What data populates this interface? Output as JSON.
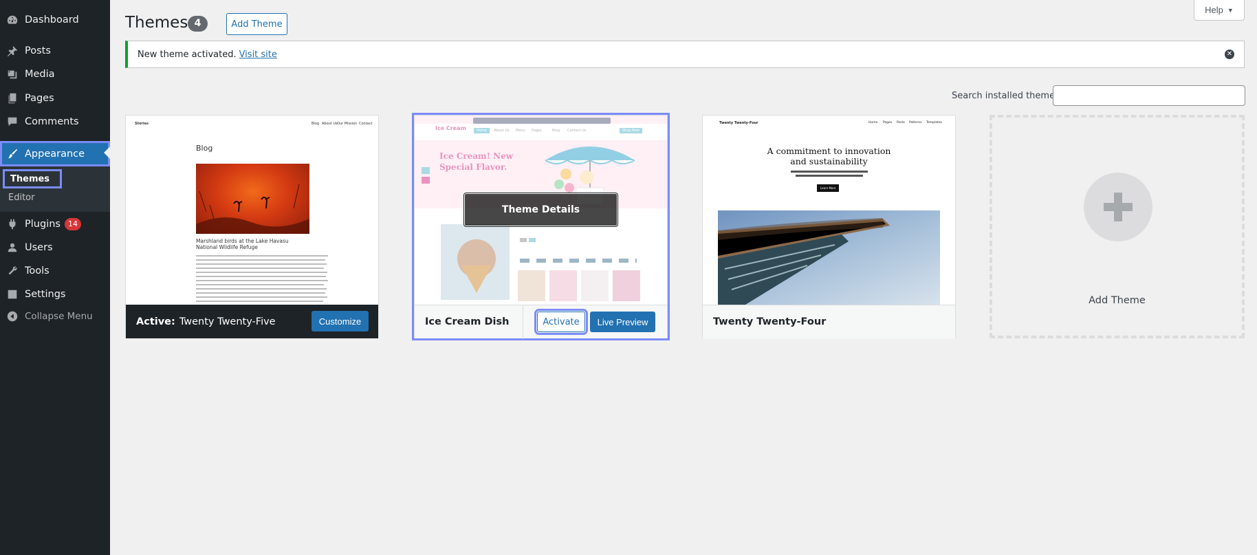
{
  "sidebar": {
    "items": [
      {
        "label": "Dashboard",
        "icon": "dashboard-icon"
      },
      {
        "label": "Posts",
        "icon": "pin-icon"
      },
      {
        "label": "Media",
        "icon": "media-icon"
      },
      {
        "label": "Pages",
        "icon": "pages-icon"
      },
      {
        "label": "Comments",
        "icon": "comment-icon"
      },
      {
        "label": "Appearance",
        "icon": "brush-icon"
      },
      {
        "label": "Plugins",
        "icon": "plugin-icon",
        "badge": "14"
      },
      {
        "label": "Users",
        "icon": "user-icon"
      },
      {
        "label": "Tools",
        "icon": "wrench-icon"
      },
      {
        "label": "Settings",
        "icon": "settings-icon"
      }
    ],
    "submenu": [
      "Themes",
      "Editor"
    ],
    "collapse_label": "Collapse Menu"
  },
  "header": {
    "title": "Themes",
    "count": "4",
    "add_theme_label": "Add Theme",
    "help_label": "Help"
  },
  "notice": {
    "text": "New theme activated.",
    "link": "Visit site"
  },
  "search": {
    "label": "Search installed themes",
    "value": ""
  },
  "themes": {
    "active": {
      "prefix": "Active:",
      "name": "Twenty Twenty-Five",
      "customize_label": "Customize",
      "shot": {
        "brand": "Stories",
        "nav": [
          "Blog",
          "About Us",
          "Our Mission",
          "Contact"
        ],
        "heading": "Blog",
        "caption": "Marshland birds at the Lake Havasu National Wildlife Refuge"
      }
    },
    "focused": {
      "name": "Ice Cream Dish",
      "details_label": "Theme Details",
      "activate_label": "Activate",
      "live_preview_label": "Live Preview",
      "shot": {
        "logo": "Ice Cream",
        "nav": [
          "Home",
          "About Us",
          "Menu",
          "Pages",
          "Blog",
          "Contact Us"
        ],
        "cta": "Shop Now",
        "headline_1": "Ice Cream! New",
        "headline_2": "Special Flavor."
      }
    },
    "third": {
      "name": "Twenty Twenty-Four",
      "shot": {
        "brand": "Twenty Twenty-Four",
        "nav": [
          "Home",
          "Pages",
          "Posts",
          "Patterns",
          "Templates"
        ],
        "headline_1": "A commitment to innovation",
        "headline_2": "and sustainability",
        "cta": "Learn More"
      }
    },
    "add_label": "Add Theme"
  },
  "colors": {
    "accent": "#2271b1",
    "sidebar_bg": "#1d2327",
    "focus_outline": "#7b8cf7",
    "notice_success": "#00a32a",
    "badge": "#d63638"
  }
}
